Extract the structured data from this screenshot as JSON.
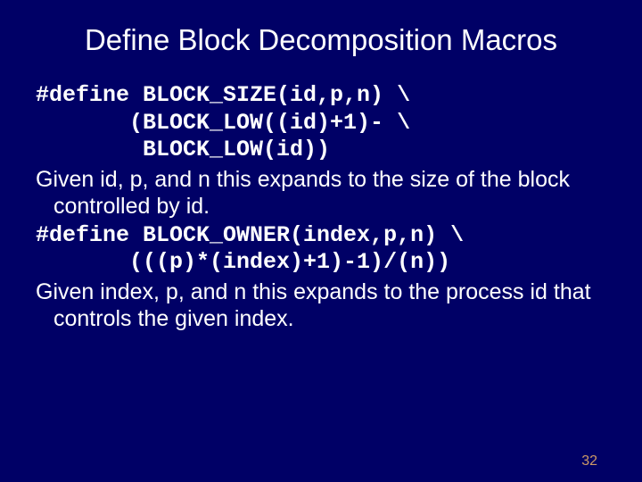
{
  "slide": {
    "title": "Define Block Decomposition Macros",
    "code1_line1": "#define BLOCK_SIZE(id,p,n) \\",
    "code1_line2": "       (BLOCK_LOW((id)+1)- \\",
    "code1_line3": "        BLOCK_LOW(id))",
    "body1": "Given id, p, and n this expands to the size of the block controlled by id.",
    "code2_line1": "#define BLOCK_OWNER(index,p,n) \\",
    "code2_line2": "       (((p)*(index)+1)-1)/(n))",
    "body2": "Given index, p, and n this expands to the process id that controls the given index.",
    "page_number": "32"
  }
}
